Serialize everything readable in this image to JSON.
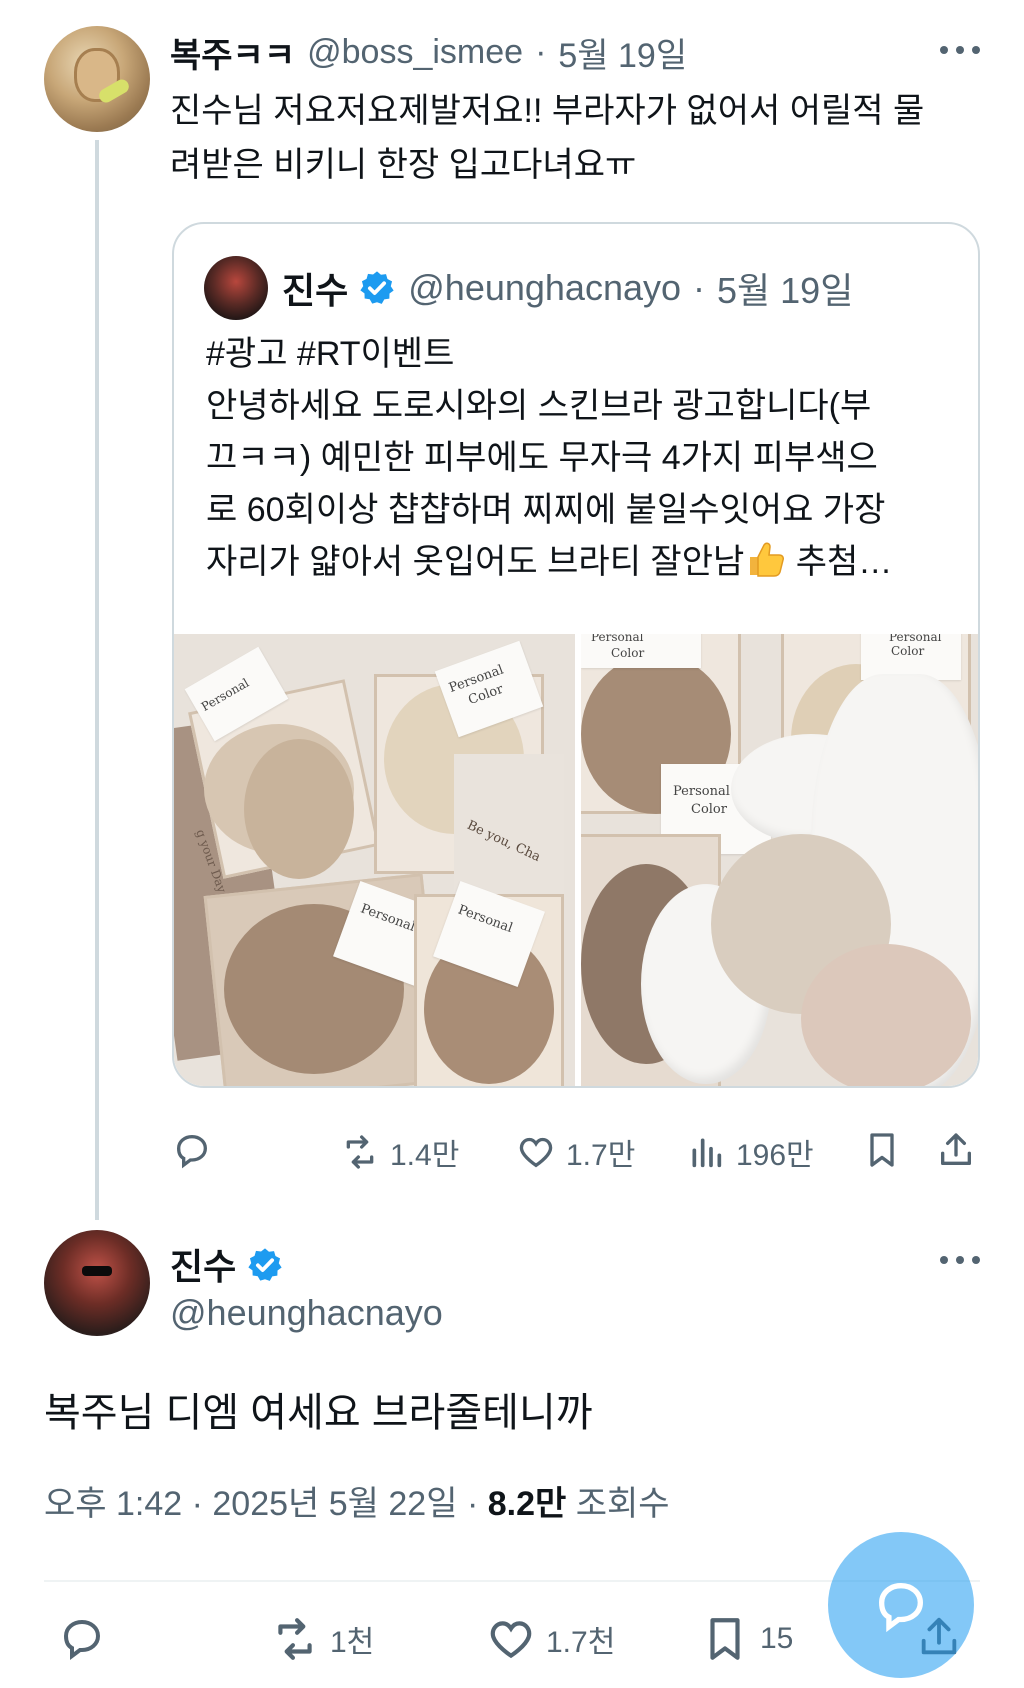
{
  "reply": {
    "name": "복주ㅋㅋ",
    "handle": "@boss_ismee",
    "separator": "·",
    "date": "5월 19일",
    "text_line1": "진수님 저요저요제발저요!! 부라자가 없어서 어릴적 물",
    "text_line2": "려받은 비키니 한장 입고다녀요ㅠ"
  },
  "quote": {
    "name": "진수",
    "handle": "@heunghacnayo",
    "separator": "·",
    "date": "5월 19일",
    "line1": "#광고 #RT이벤트",
    "line2": "안녕하세요 도로시와의 스킨브라 광고합니다(부",
    "line3": "끄ㅋㅋ) 예민한 피부에도 무자극 4가지 피부색으",
    "line4": "로 60회이상 챱챱하며 찌찌에 붙일수잇어요 가장",
    "line5_before": "자리가 얇아서 옷입어도 브라티 잘안남",
    "line5_after": " 추첨…",
    "image_labels": {
      "personal": "Personal",
      "color": "Color",
      "be_you": "Be you, Cha",
      "day": "g your Day"
    },
    "stats": {
      "retweets": "1.4만",
      "likes": "1.7만",
      "views": "196만"
    }
  },
  "main": {
    "name": "진수",
    "handle": "@heunghacnayo",
    "text": "복주님 디엠 여세요 브라줄테니까",
    "time": "오후 1:42 · 2025년 5월 22일 · ",
    "views_count": "8.2만",
    "views_label": " 조회수",
    "stats": {
      "retweets": "1천",
      "likes": "1.7천",
      "bookmarks": "15"
    }
  },
  "colors": {
    "text_primary": "#0f1419",
    "text_secondary": "#536471",
    "border": "#cfd9de",
    "verified": "#1d9bf0",
    "fab": "#1d9bf0"
  }
}
